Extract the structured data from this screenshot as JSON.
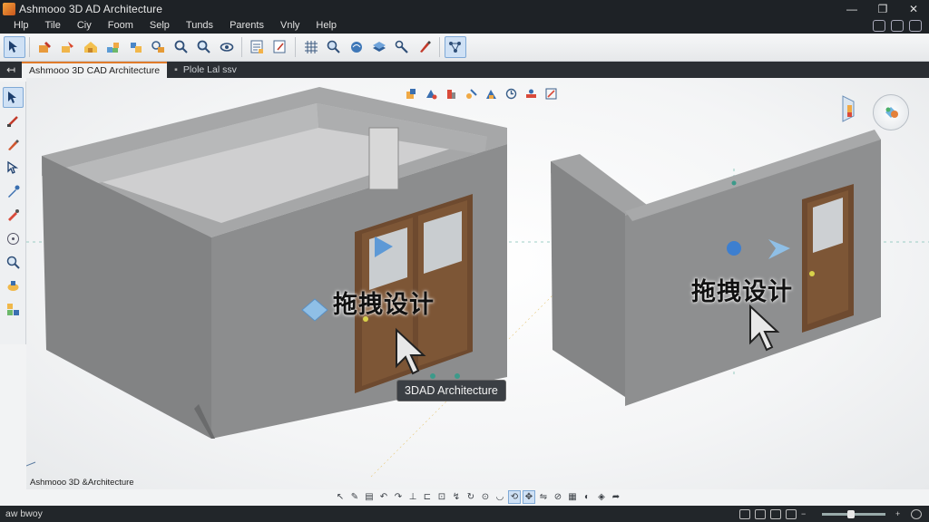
{
  "window": {
    "title": "Ashmooo 3D AD Architecture",
    "controls": [
      "—",
      "❐",
      "✕"
    ]
  },
  "menu": {
    "items": [
      "Hlp",
      "Tile",
      "Ciy",
      "Foom",
      "Selp",
      "Tunds",
      "Parents",
      "Vnly",
      "Help"
    ]
  },
  "tabs": {
    "active_label": "Ashmooo 3D CAD Architecture",
    "second_label": "Plole Lal ssv"
  },
  "viewport": {
    "left_label": "拖拽设计",
    "right_label": "拖拽设计",
    "tooltip": "3DAD Architecture",
    "caption": "Ashmooo 3D &Architecture"
  },
  "status": {
    "text": "aw bwoy",
    "zoom_level": 0.45
  },
  "colors": {
    "wall": "#8a8b8c",
    "door": "#7a5235",
    "accent": "#2f6fb5",
    "gizmo": "#3c9a8a"
  }
}
